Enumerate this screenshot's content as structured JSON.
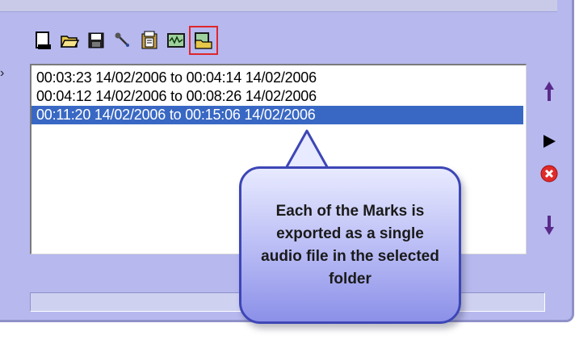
{
  "toolbar": {
    "buttons": [
      {
        "icon": "new-document-icon"
      },
      {
        "icon": "open-folder-icon"
      },
      {
        "icon": "save-disk-icon"
      },
      {
        "icon": "wrench-icon"
      },
      {
        "icon": "clipboard-icon"
      },
      {
        "icon": "waveform-icon"
      },
      {
        "icon": "export-folder-icon",
        "selected": true
      }
    ]
  },
  "marks": [
    {
      "text": "00:03:23 14/02/2006 to 00:04:14 14/02/2006",
      "selected": false
    },
    {
      "text": "00:04:12 14/02/2006 to 00:08:26 14/02/2006",
      "selected": false
    },
    {
      "text": "00:11:20 14/02/2006 to 00:15:06 14/02/2006",
      "selected": true
    }
  ],
  "side_buttons": [
    "move-up-icon",
    "play-icon",
    "delete-icon",
    "move-down-icon"
  ],
  "callout": {
    "text": "Each of the Marks is exported as a single audio file in the selected folder"
  },
  "colors": {
    "panel": "#b6b8ee",
    "selection": "#3968c4",
    "highlight_border": "#e0262b",
    "callout_border": "#3d46b6"
  }
}
